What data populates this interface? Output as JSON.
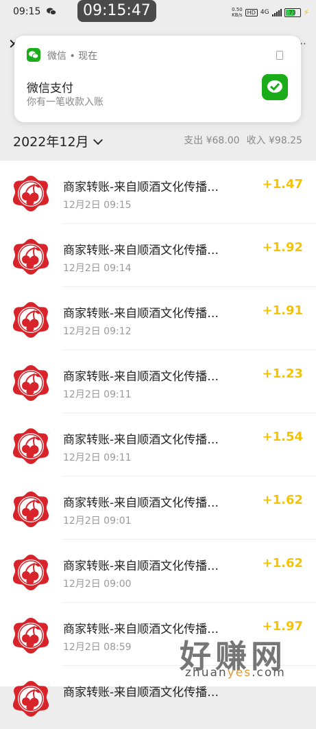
{
  "status": {
    "time": "09:15",
    "center_time": "09:15:47",
    "speed_value": "0.50",
    "speed_unit": "KB/s",
    "hd": "HD",
    "network": "4G",
    "battery": "73",
    "battery_level": 0.73
  },
  "notification": {
    "app": "微信 • 现在",
    "title": "微信支付",
    "body": "你有一笔收款入账"
  },
  "bill": {
    "month": "2022年12月",
    "expense": "支出 ¥68.00",
    "income": "收入 ¥98.25"
  },
  "transactions": [
    {
      "title": "商家转账-来自顺酒文化传播…",
      "time": "12月2日 09:15",
      "amount": "+1.47"
    },
    {
      "title": "商家转账-来自顺酒文化传播…",
      "time": "12月2日 09:14",
      "amount": "+1.92"
    },
    {
      "title": "商家转账-来自顺酒文化传播…",
      "time": "12月2日 09:12",
      "amount": "+1.91"
    },
    {
      "title": "商家转账-来自顺酒文化传播…",
      "time": "12月2日 09:11",
      "amount": "+1.23"
    },
    {
      "title": "商家转账-来自顺酒文化传播…",
      "time": "12月2日 09:11",
      "amount": "+1.54"
    },
    {
      "title": "商家转账-来自顺酒文化传播…",
      "time": "12月2日 09:01",
      "amount": "+1.62"
    },
    {
      "title": "商家转账-来自顺酒文化传播…",
      "time": "12月2日 09:00",
      "amount": "+1.62"
    },
    {
      "title": "商家转账-来自顺酒文化传播…",
      "time": "12月2日 08:59",
      "amount": "+1.97"
    },
    {
      "title": "商家转账-来自顺酒文化传播…",
      "time": "",
      "amount": ""
    }
  ],
  "watermark": {
    "brand": "好赚网",
    "url_a": "zhuan",
    "url_b": "yes",
    "url_c": ".com"
  },
  "colors": {
    "income": "#f4c400",
    "logo_red": "#d8232a",
    "wechat_green": "#1aad19"
  }
}
